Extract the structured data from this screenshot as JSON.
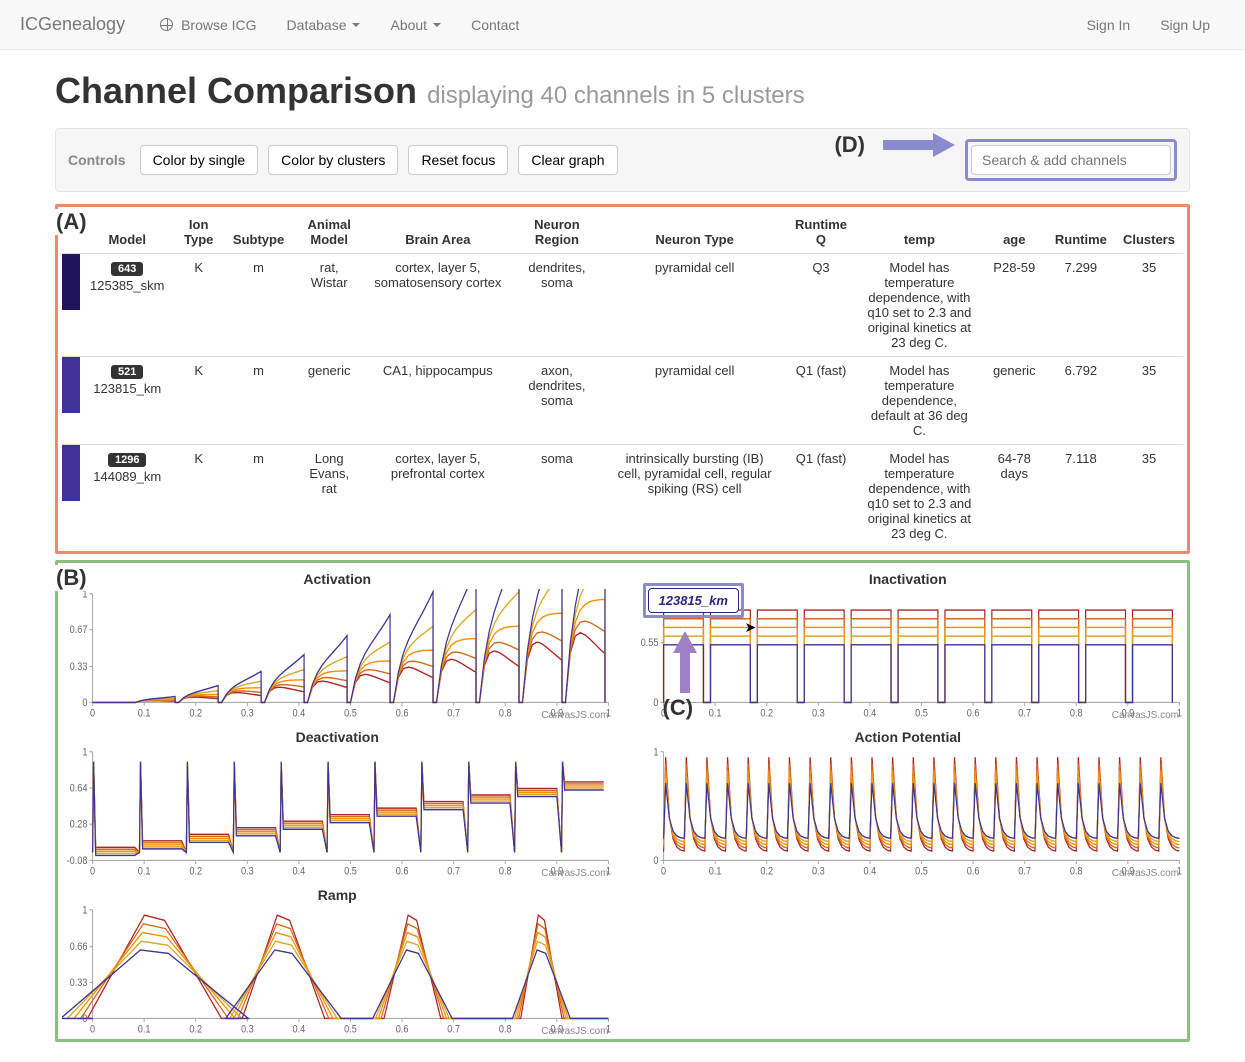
{
  "nav": {
    "brand": "ICGenealogy",
    "items": [
      "Browse ICG",
      "Database",
      "About",
      "Contact"
    ],
    "right": [
      "Sign In",
      "Sign Up"
    ]
  },
  "title": {
    "main": "Channel Comparison",
    "sub": "displaying 40 channels in 5 clusters"
  },
  "controls": {
    "label": "Controls",
    "buttons": [
      "Color by single",
      "Color by clusters",
      "Reset focus",
      "Clear graph"
    ],
    "search_placeholder": "Search & add channels"
  },
  "annotations": {
    "a": "(A)",
    "b": "(B)",
    "c": "(C)",
    "d": "(D)"
  },
  "table": {
    "headers": [
      "",
      "Model",
      "Ion Type",
      "Subtype",
      "Animal Model",
      "Brain Area",
      "Neuron Region",
      "Neuron Type",
      "Runtime Q",
      "temp",
      "age",
      "Runtime",
      "Clusters"
    ],
    "rows": [
      {
        "color": "#1d165f",
        "badge": "643",
        "model": "125385_skm",
        "ion": "K",
        "subtype": "m",
        "animal": "rat, Wistar",
        "brain": "cortex, layer 5, somatosensory cortex",
        "region": "dendrites, soma",
        "ntype": "pyramidal cell",
        "rq": "Q3",
        "temp": "Model has temperature dependence, with q10 set to 2.3 and original kinetics at 23 deg C.",
        "age": "P28-59",
        "runtime": "7.299",
        "clusters": "35"
      },
      {
        "color": "#3d3396",
        "badge": "521",
        "model": "123815_km",
        "ion": "K",
        "subtype": "m",
        "animal": "generic",
        "brain": "CA1, hippocampus",
        "region": "axon, dendrites, soma",
        "ntype": "pyramidal cell",
        "rq": "Q1 (fast)",
        "temp": "Model has temperature dependence, default at 36 deg C.",
        "age": "generic",
        "runtime": "6.792",
        "clusters": "35"
      },
      {
        "color": "#3d3396",
        "badge": "1296",
        "model": "144089_km",
        "ion": "K",
        "subtype": "m",
        "animal": "Long Evans, rat",
        "brain": "cortex, layer 5, prefrontal cortex",
        "region": "soma",
        "ntype": "intrinsically bursting (IB) cell, pyramidal cell, regular spiking (RS) cell",
        "rq": "Q1 (fast)",
        "temp": "Model has temperature dependence, with q10 set to 2.3 and original kinetics at 23 deg C.",
        "age": "64-78 days",
        "runtime": "7.118",
        "clusters": "35"
      }
    ]
  },
  "tooltip": "123815_km",
  "charts": {
    "credit": "CanvasJS.com",
    "panels": [
      {
        "title": "Activation",
        "type": "activation"
      },
      {
        "title": "Inactivation",
        "type": "inactivation"
      },
      {
        "title": "Deactivation",
        "type": "deactivation"
      },
      {
        "title": "Action Potential",
        "type": "ap"
      },
      {
        "title": "Ramp",
        "type": "ramp"
      }
    ]
  },
  "chart_data": {
    "type": "line",
    "credit": "CanvasJS.com",
    "xlim": [
      0,
      1
    ],
    "panels": {
      "Activation": {
        "ylim": [
          0,
          1
        ],
        "yticks": [
          0,
          0.33,
          0.67,
          1
        ],
        "xticks": [
          0,
          0.1,
          0.2,
          0.3,
          0.4,
          0.5,
          0.6,
          0.7,
          0.8,
          0.9,
          1
        ],
        "note": "step-pulse family, amplitude rises with x"
      },
      "Inactivation": {
        "ylim": [
          0,
          1
        ],
        "yticks": [
          0,
          0.55,
          1
        ],
        "xticks": [
          0,
          0.1,
          0.2,
          0.3,
          0.4,
          0.5,
          0.6,
          0.7,
          0.8,
          0.9,
          1
        ],
        "note": "square-pulse family, roughly constant amplitude"
      },
      "Deactivation": {
        "ylim": [
          -0.08,
          1
        ],
        "yticks": [
          -0.08,
          0.28,
          0.64,
          1
        ],
        "xticks": [
          0,
          0.1,
          0.2,
          0.3,
          0.4,
          0.5,
          0.6,
          0.7,
          0.8,
          0.9,
          1
        ],
        "note": "narrow spikes then plateau steps increasing"
      },
      "Action Potential": {
        "ylim": [
          0,
          1
        ],
        "yticks": [
          0,
          1
        ],
        "xticks": [
          0,
          0.1,
          0.2,
          0.3,
          0.4,
          0.5,
          0.6,
          0.7,
          0.8,
          0.9,
          1
        ],
        "note": "train of ~25 sharp spikes"
      },
      "Ramp": {
        "ylim": [
          0,
          1
        ],
        "yticks": [
          0,
          0.33,
          0.66,
          1
        ],
        "xticks": [
          0,
          0.1,
          0.2,
          0.3,
          0.4,
          0.5,
          0.6,
          0.7,
          0.8,
          0.9,
          1
        ],
        "note": "triangular ramp envelopes at x≈0.12,0.37,0.62,0.87"
      }
    },
    "trace_colors": [
      "#b22222",
      "#d2691e",
      "#ff8c00",
      "#daa520",
      "#3d3396"
    ]
  }
}
